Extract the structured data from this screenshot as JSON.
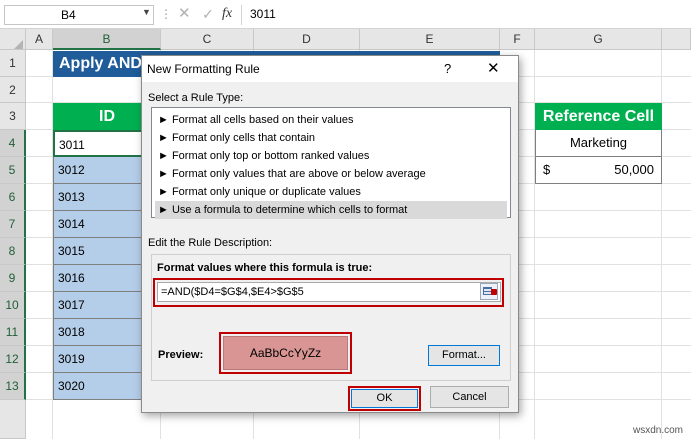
{
  "formula_bar": {
    "name_box": "B4",
    "name_box_arrow": "▼",
    "dots": "⋮",
    "cancel_icon": "✕",
    "enter_icon": "✓",
    "fx": "fx",
    "value": "3011"
  },
  "columns": [
    "A",
    "B",
    "C",
    "D",
    "E",
    "F",
    "G"
  ],
  "rows": [
    "1",
    "2",
    "3",
    "4",
    "5",
    "6",
    "7",
    "8",
    "9",
    "10",
    "11",
    "12",
    "13"
  ],
  "sheet": {
    "title": "Apply AND",
    "id_header": "ID",
    "ids": [
      "3011",
      "3012",
      "3013",
      "3014",
      "3015",
      "3016",
      "3017",
      "3018",
      "3019",
      "3020"
    ],
    "reference": {
      "header": "Reference Cell",
      "department": "Marketing",
      "currency": "$",
      "salary": "50,000"
    }
  },
  "dialog": {
    "title": "New Formatting Rule",
    "help": "?",
    "close": "✕",
    "rule_type_label": "Select a Rule Type:",
    "rule_types": [
      "► Format all cells based on their values",
      "► Format only cells that contain",
      "► Format only top or bottom ranked values",
      "► Format only values that are above or below average",
      "► Format only unique or duplicate values",
      "► Use a formula to determine which cells to format"
    ],
    "rule_desc_label": "Edit the Rule Description:",
    "formula_label": "Format values where this formula is true:",
    "formula": "=AND($D4=$G$4,$E4>$G$5",
    "preview_label": "Preview:",
    "preview_text": "AaBbCcYyZz",
    "format_button": "Format...",
    "ok_button": "OK",
    "cancel_button": "Cancel"
  },
  "colors": {
    "banner": "#1f5c99",
    "header_green": "#00b050",
    "id_fill": "#b4cde8",
    "preview_fill": "#d99594",
    "highlight_red": "#c00000"
  },
  "watermark": "wsxdn.com"
}
